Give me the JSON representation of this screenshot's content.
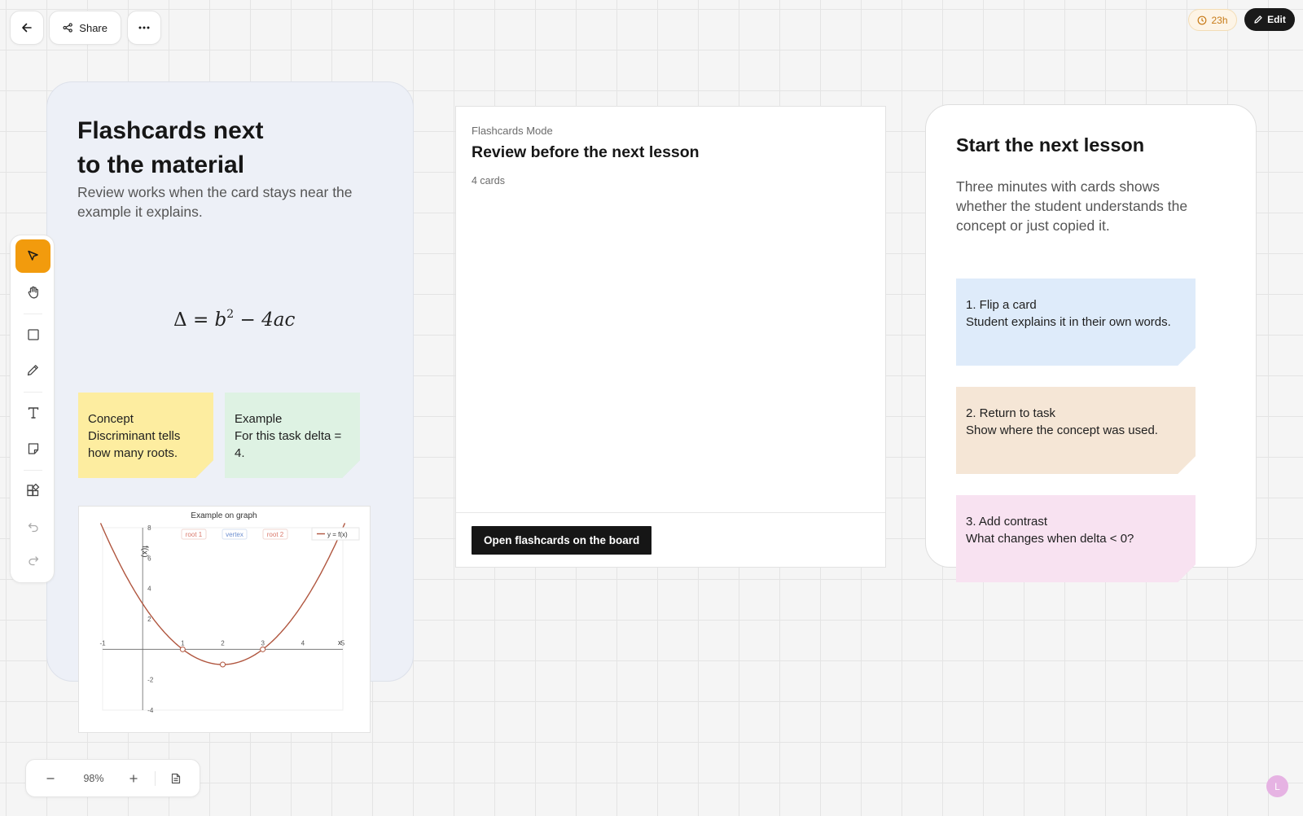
{
  "topbar": {
    "share_label": "Share",
    "timer_label": "23h",
    "edit_label": "Edit"
  },
  "left_frame": {
    "title_line1": "Flashcards next",
    "title_line2": "to the material",
    "description": "Review works when the card stays near the example it explains.",
    "formula": {
      "lhs": "Δ",
      "eq": "=",
      "b": "b",
      "exp": "2",
      "minus": "−",
      "rhs": "4ac"
    },
    "stickies": [
      {
        "title": "Concept",
        "body": "Discriminant tells how many roots.",
        "color": "#fdeda0",
        "fold": "#eedb84"
      },
      {
        "title": "Example",
        "body": "For this task delta = 4.",
        "color": "#def2e3",
        "fold": "#c8e4cf"
      }
    ]
  },
  "graph": {
    "title": "Example on graph",
    "badges": [
      "root 1",
      "vertex",
      "root 2"
    ],
    "legend": "y = f(x)",
    "y_axis_label": "f(x)",
    "x_axis_label": "x"
  },
  "chart_data": {
    "type": "line",
    "title": "Example on graph",
    "xlabel": "x",
    "ylabel": "f(x)",
    "xlim": [
      -1,
      5
    ],
    "ylim": [
      -4,
      8
    ],
    "x_ticks": [
      "-1",
      "1",
      "2",
      "3",
      "4",
      "5"
    ],
    "y_ticks": [
      "8",
      "6",
      "4",
      "2",
      "-2",
      "-4"
    ],
    "series": [
      {
        "name": "y = f(x)",
        "function": "x^2 - 4x + 3",
        "color": "#b0563f"
      }
    ],
    "markers": [
      {
        "label": "root 1",
        "x": 1,
        "y": 0,
        "color": "#d9776a"
      },
      {
        "label": "vertex",
        "x": 2,
        "y": -1,
        "color": "#6d8fd0"
      },
      {
        "label": "root 2",
        "x": 3,
        "y": 0,
        "color": "#d9776a"
      }
    ],
    "grid": false,
    "legend_position": "top-right"
  },
  "middle_card": {
    "mode_label": "Flashcards Mode",
    "title": "Review before the next lesson",
    "count": "4 cards",
    "button_label": "Open flashcards on the board"
  },
  "right_frame": {
    "title": "Start the next lesson",
    "description": "Three minutes with cards shows whether the student understands the concept or just copied it.",
    "stickies": [
      {
        "title": "1. Flip a card",
        "body": "Student explains it in their own words.",
        "color": "#deebfa",
        "fold": "#c6d8ee"
      },
      {
        "title": "2. Return to task",
        "body": "Show where the concept was used.",
        "color": "#f5e6d6",
        "fold": "#e7d1bb"
      },
      {
        "title": "3. Add contrast",
        "body": "What changes when delta < 0?",
        "color": "#f8e2f1",
        "fold": "#ebcadf"
      }
    ]
  },
  "toolbar": {
    "tools": [
      "select-tool",
      "hand-tool",
      "rectangle-tool",
      "pen-tool",
      "text-tool",
      "sticky-note-tool",
      "components-tool",
      "undo",
      "redo"
    ]
  },
  "zoom": {
    "level": "98%"
  },
  "user": {
    "initial": "L"
  }
}
